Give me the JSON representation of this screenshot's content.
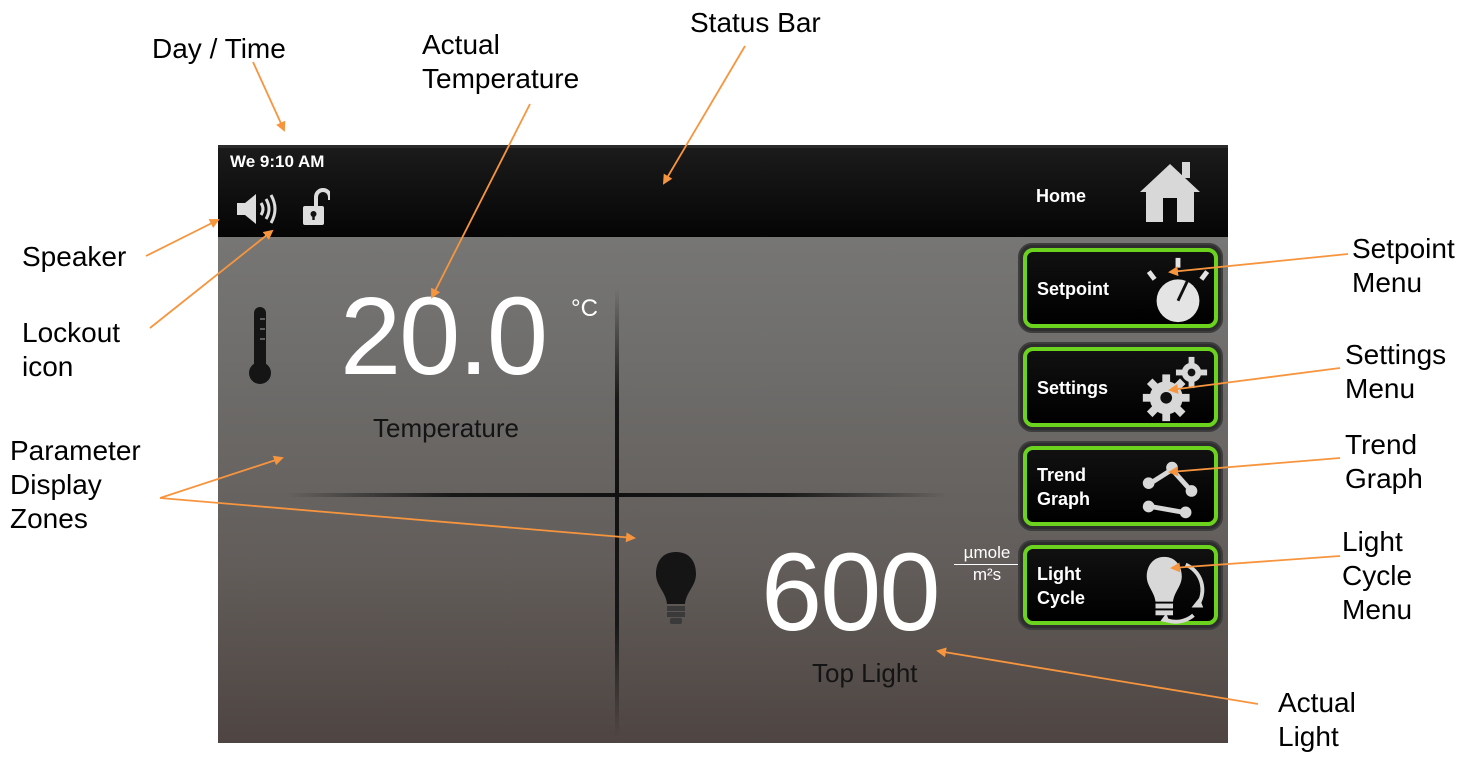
{
  "callouts": {
    "day_time": "Day / Time",
    "actual_temperature": "Actual\nTemperature",
    "status_bar": "Status Bar",
    "speaker": "Speaker",
    "lockout_icon": "Lockout\nicon",
    "parameter_display_zones": "Parameter\nDisplay\nZones",
    "setpoint_menu": "Setpoint\nMenu",
    "settings_menu": "Settings\nMenu",
    "trend_graph": "Trend\nGraph",
    "light_cycle_menu": "Light\nCycle\nMenu",
    "actual_light": "Actual\nLight",
    "arrow_color": "#f7953f"
  },
  "status_bar": {
    "day_time": "We 9:10 AM",
    "speaker_icon": "speaker-icon",
    "lock_icon": "unlocked-padlock-icon",
    "home_label": "Home",
    "home_icon": "home-icon"
  },
  "temperature": {
    "value": "20.0",
    "unit": "°C",
    "label": "Temperature",
    "icon": "thermometer-icon"
  },
  "light": {
    "value": "600",
    "unit_numerator": "µmole",
    "unit_denominator": "m²s",
    "label": "Top Light",
    "icon": "light-bulb-icon"
  },
  "menu": {
    "accent_color": "#6bd31e",
    "setpoint": {
      "label": "Setpoint",
      "icon": "dial-icon"
    },
    "settings": {
      "label": "Settings",
      "icon": "gears-icon"
    },
    "trend_graph": {
      "label": "Trend\nGraph",
      "icon": "trend-graph-icon"
    },
    "light_cycle": {
      "label": "Light\nCycle",
      "icon": "light-cycle-icon"
    }
  }
}
